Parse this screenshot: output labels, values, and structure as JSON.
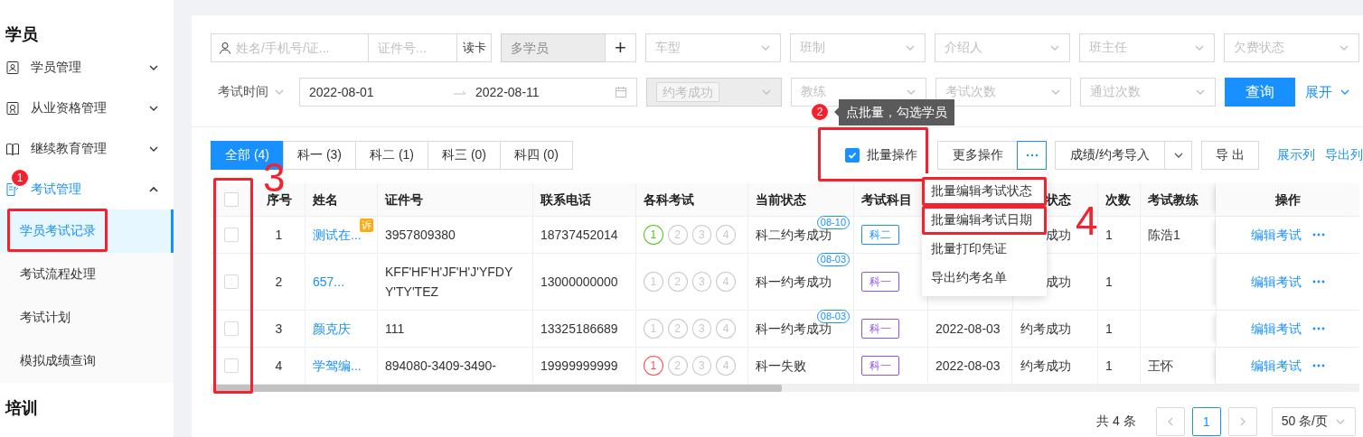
{
  "sidebar": {
    "sections": [
      {
        "title": "学员",
        "items": [
          {
            "label": "学员管理",
            "expanded": false,
            "active": false
          },
          {
            "label": "从业资格管理",
            "expanded": false,
            "active": false
          },
          {
            "label": "继续教育管理",
            "expanded": false,
            "active": false
          },
          {
            "label": "考试管理",
            "expanded": true,
            "active": true,
            "children": [
              {
                "label": "学员考试记录",
                "selected": true
              },
              {
                "label": "考试流程处理",
                "selected": false
              },
              {
                "label": "考试计划",
                "selected": false
              },
              {
                "label": "模拟成绩查询",
                "selected": false
              }
            ]
          }
        ]
      },
      {
        "title": "培训"
      }
    ]
  },
  "filters": {
    "name_search": {
      "placeholder": "姓名/手机号/证..."
    },
    "id_search": {
      "placeholder": "证件号..."
    },
    "read_card_button": "读卡",
    "multi_student": {
      "placeholder": "多学员",
      "disabled": true
    },
    "add_button": "+",
    "selects": [
      {
        "placeholder": "车型"
      },
      {
        "placeholder": "班制"
      },
      {
        "placeholder": "介绍人"
      },
      {
        "placeholder": "班主任"
      },
      {
        "placeholder": "欠费状态"
      }
    ],
    "time_type": "考试时间",
    "date_start": "2022-08-01",
    "date_end": "2022-08-11",
    "status_select": {
      "tag": "约考成功",
      "disabled": true
    },
    "selects_2": [
      {
        "placeholder": "教练"
      },
      {
        "placeholder": "考试次数"
      },
      {
        "placeholder": "通过次数"
      }
    ],
    "query_button": "查询",
    "expand_link": "展开"
  },
  "tabs": [
    {
      "label": "全部 (4)",
      "selected": true
    },
    {
      "label": "科一 (3)",
      "selected": false
    },
    {
      "label": "科二 (1)",
      "selected": false
    },
    {
      "label": "科三 (0)",
      "selected": false
    },
    {
      "label": "科四 (0)",
      "selected": false
    }
  ],
  "toolbar": {
    "batch_mode": {
      "label": "批量操作",
      "checked": true
    },
    "more_button": "更多操作",
    "import_button": "成绩/约考导入",
    "export_button": "导 出",
    "links": [
      "展示列",
      "导出列"
    ]
  },
  "table": {
    "select_all": {
      "checked": false
    },
    "columns": [
      "序号",
      "姓名",
      "证件号",
      "联系电话",
      "各科考试",
      "当前状态",
      "考试科目",
      "状态",
      "次数",
      "考试教练",
      "操作"
    ],
    "rows": [
      {
        "checked": false,
        "index": "1",
        "name": "测试在...",
        "appeal": "诉",
        "id": "3957809380",
        "phone": "18737452014",
        "exams": [
          {
            "label": "1",
            "color": "#52c41a"
          },
          {
            "label": "2",
            "color": "#c8c8c8"
          },
          {
            "label": "3",
            "color": "#c8c8c8"
          },
          {
            "label": "4",
            "color": "#c8c8c8"
          }
        ],
        "status": "科二约考成功",
        "status_date": "08-10",
        "subject": {
          "label": "科二",
          "color": "#1890ff"
        },
        "booking": "成功",
        "count": "1",
        "coach": "陈浩1",
        "action": "编辑考试"
      },
      {
        "checked": false,
        "index": "2",
        "name": "657...",
        "id": "KFF'HF'H'JF'H'J'YFDYY'TY'TEZ",
        "phone": "13000000000",
        "exams": [
          {
            "label": "1",
            "color": "#c8c8c8"
          },
          {
            "label": "2",
            "color": "#c8c8c8"
          },
          {
            "label": "3",
            "color": "#c8c8c8"
          },
          {
            "label": "4",
            "color": "#c8c8c8"
          }
        ],
        "status": "科一约考成功",
        "status_date": "08-03",
        "subject": {
          "label": "科一",
          "color": "#9254de"
        },
        "booking": "成功",
        "count": "1",
        "action": "编辑考试"
      },
      {
        "checked": false,
        "index": "3",
        "name": "颜克庆",
        "id": "111",
        "phone": "13325186689",
        "exams": [
          {
            "label": "1",
            "color": "#c8c8c8"
          },
          {
            "label": "2",
            "color": "#c8c8c8"
          },
          {
            "label": "3",
            "color": "#c8c8c8"
          },
          {
            "label": "4",
            "color": "#c8c8c8"
          }
        ],
        "status": "科一约考成功",
        "status_date": "08-03",
        "subject": {
          "label": "科一",
          "color": "#9254de"
        },
        "exam_date": "2022-08-03",
        "booking": "约考成功",
        "count": "1",
        "action": "编辑考试"
      },
      {
        "checked": false,
        "index": "4",
        "name": "学驾编...",
        "id": "894080-3409-3490-",
        "phone": "19999999999",
        "exams": [
          {
            "label": "1",
            "color": "#ff4d4f"
          },
          {
            "label": "2",
            "color": "#c8c8c8"
          },
          {
            "label": "3",
            "color": "#c8c8c8"
          },
          {
            "label": "4",
            "color": "#c8c8c8"
          }
        ],
        "status": "科一失败",
        "subject": {
          "label": "科一",
          "color": "#9254de"
        },
        "exam_date": "2022-08-03",
        "booking": "约考成功",
        "count": "1",
        "coach": "王怀",
        "action": "编辑考试"
      }
    ]
  },
  "pagination": {
    "total": "共 4 条",
    "pages": [
      {
        "label": "1",
        "selected": true
      }
    ],
    "page_size": "50 条/页"
  },
  "more_menu": {
    "items": [
      "批量编辑考试状态",
      "批量编辑考试日期",
      "批量打印凭证",
      "导出约考名单"
    ]
  },
  "annotations": [
    {
      "kind": "badge",
      "label": "1"
    },
    {
      "kind": "badge",
      "label": "2"
    },
    {
      "kind": "numeral",
      "label": "3"
    },
    {
      "kind": "numeral",
      "label": "4"
    }
  ],
  "hint_tooltip": "点批量，勾选学员"
}
